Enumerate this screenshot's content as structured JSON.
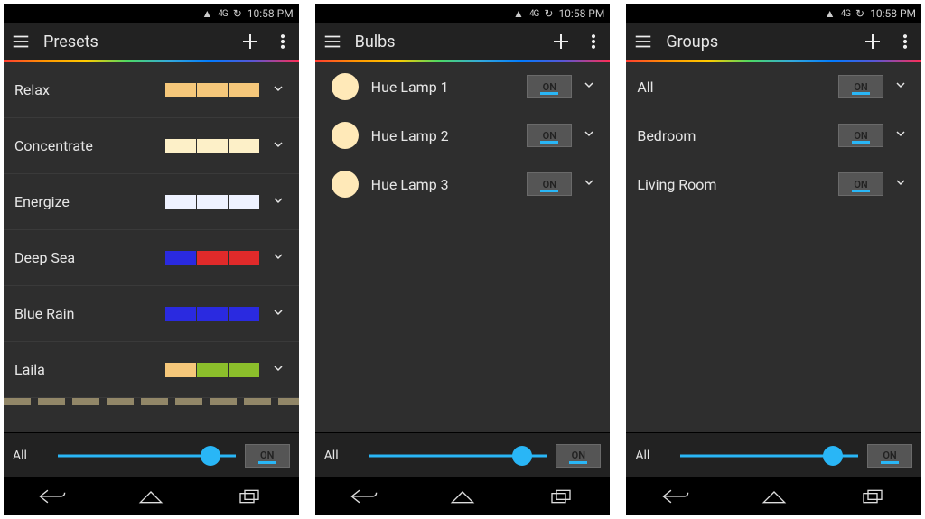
{
  "status": {
    "carrier": "4G",
    "time": "10:58 PM"
  },
  "screens": [
    {
      "title": "Presets",
      "type": "presets",
      "presets": [
        {
          "name": "Relax",
          "colors": [
            "#f5c77a",
            "#f5c77a",
            "#f5c77a"
          ]
        },
        {
          "name": "Concentrate",
          "colors": [
            "#fdf0c8",
            "#fdf0c8",
            "#fdf0c8"
          ]
        },
        {
          "name": "Energize",
          "colors": [
            "#eef2ff",
            "#eef2ff",
            "#eef2ff"
          ]
        },
        {
          "name": "Deep Sea",
          "colors": [
            "#2a2ae0",
            "#e02a2a",
            "#e02a2a"
          ]
        },
        {
          "name": "Blue Rain",
          "colors": [
            "#2a2ae0",
            "#2a2ae0",
            "#2a2ae0"
          ]
        },
        {
          "name": "Laila",
          "colors": [
            "#f5c77a",
            "#8bbf2b",
            "#8bbf2b"
          ]
        }
      ]
    },
    {
      "title": "Bulbs",
      "type": "bulbs",
      "bulbs": [
        {
          "name": "Hue Lamp 1",
          "state": "ON"
        },
        {
          "name": "Hue Lamp 2",
          "state": "ON"
        },
        {
          "name": "Hue Lamp 3",
          "state": "ON"
        }
      ]
    },
    {
      "title": "Groups",
      "type": "groups",
      "groups": [
        {
          "name": "All",
          "state": "ON"
        },
        {
          "name": "Bedroom",
          "state": "ON"
        },
        {
          "name": "Living Room",
          "state": "ON"
        }
      ]
    }
  ],
  "bottom": {
    "label": "All",
    "slider_pct": 86,
    "toggle": "ON"
  }
}
